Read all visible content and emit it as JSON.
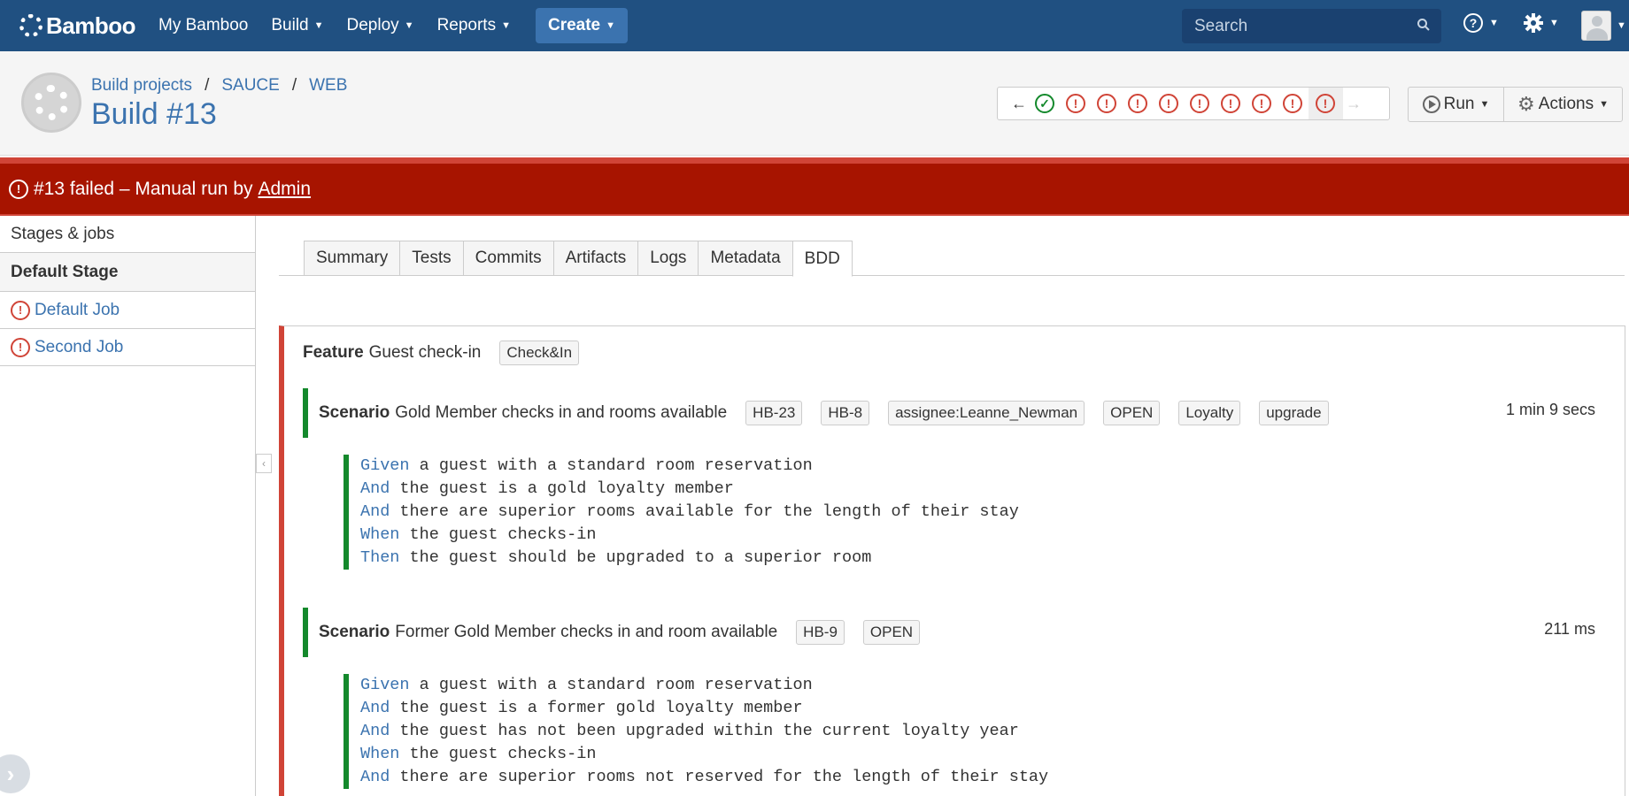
{
  "nav": {
    "logo": "Bamboo",
    "items": [
      "My Bamboo",
      "Build",
      "Deploy",
      "Reports"
    ],
    "create": "Create",
    "search_placeholder": "Search"
  },
  "header": {
    "breadcrumbs": [
      "Build projects",
      "SAUCE",
      "WEB"
    ],
    "title": "Build #13",
    "history": [
      "success",
      "failed",
      "failed",
      "failed",
      "failed",
      "failed",
      "failed",
      "failed",
      "failed",
      "failed"
    ],
    "run_label": "Run",
    "actions_label": "Actions"
  },
  "status": {
    "text": "#13 failed – Manual run by",
    "user": "Admin",
    "colors": {
      "bar": "#a71400",
      "accent": "#d04437"
    }
  },
  "sidebar": {
    "heading": "Stages & jobs",
    "stage": "Default Stage",
    "jobs": [
      "Default Job",
      "Second Job"
    ]
  },
  "tabs": [
    "Summary",
    "Tests",
    "Commits",
    "Artifacts",
    "Logs",
    "Metadata",
    "BDD"
  ],
  "active_tab": "BDD",
  "feature": {
    "keyword": "Feature",
    "name": "Guest check-in",
    "tag": "Check&In",
    "scenarios": [
      {
        "keyword": "Scenario",
        "name": "Gold Member checks in and rooms available",
        "tags": [
          "HB-23",
          "HB-8",
          "assignee:Leanne_Newman",
          "OPEN",
          "Loyalty",
          "upgrade"
        ],
        "duration": "1 min 9 secs",
        "steps": [
          {
            "kw": "Given",
            "text": " a guest with a standard room reservation"
          },
          {
            "kw": "And",
            "text": " the guest is a gold loyalty member"
          },
          {
            "kw": "And",
            "text": " there are superior rooms available for the length of their stay"
          },
          {
            "kw": "When",
            "text": " the guest checks-in"
          },
          {
            "kw": "Then",
            "text": " the guest should be upgraded to a superior room"
          }
        ]
      },
      {
        "keyword": "Scenario",
        "name": "Former Gold Member checks in and room available",
        "tags": [
          "HB-9",
          "OPEN"
        ],
        "duration": "211 ms",
        "steps": [
          {
            "kw": "Given",
            "text": " a guest with a standard room reservation"
          },
          {
            "kw": "And",
            "text": " the guest is a former gold loyalty member"
          },
          {
            "kw": "And",
            "text": " the guest has not been upgraded within the current loyalty year"
          },
          {
            "kw": "When",
            "text": " the guest checks-in"
          },
          {
            "kw": "And",
            "text": " there are superior rooms not reserved for the length of their stay"
          }
        ]
      }
    ]
  }
}
